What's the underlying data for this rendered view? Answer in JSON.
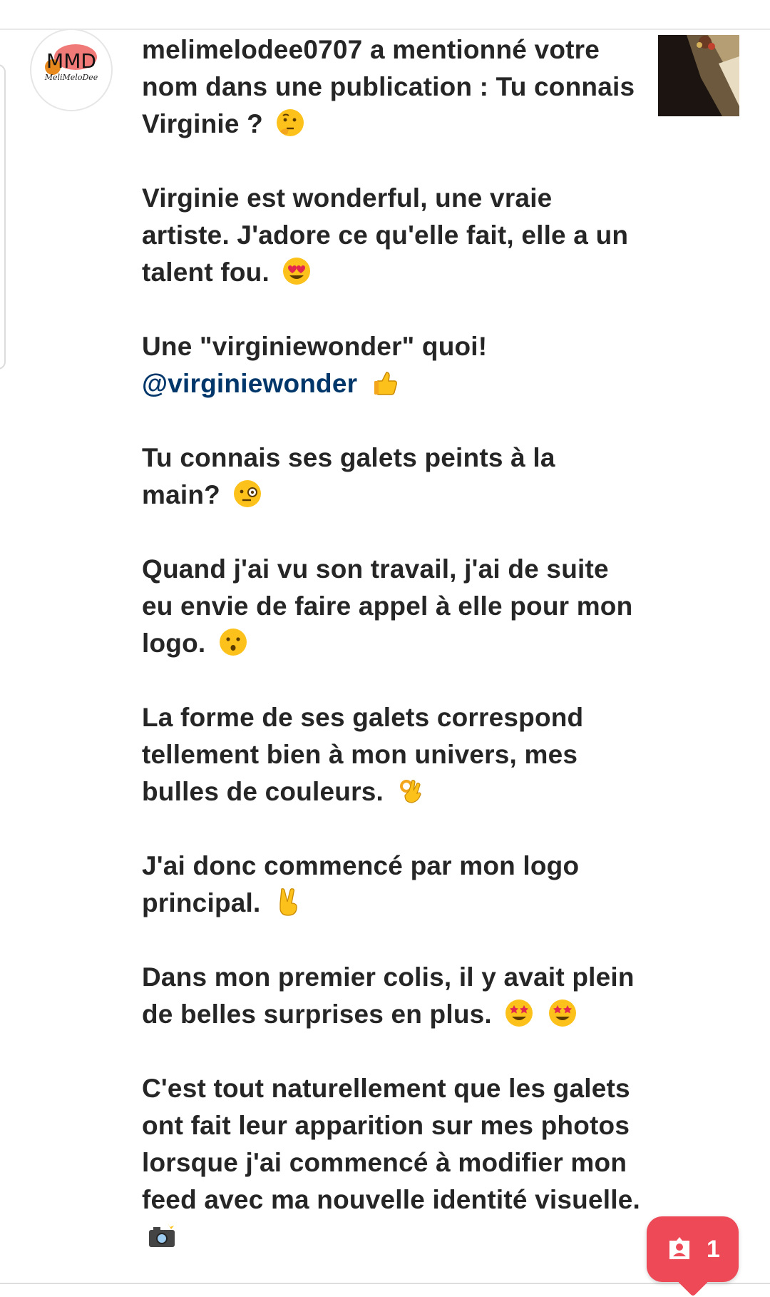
{
  "notification": {
    "username": "melimelodee0707",
    "mention_text": " a mentionné votre nom dans une publication : Tu connais Virginie ?",
    "paragraphs": [
      {
        "text": "Virginie est wonderful, une vraie artiste. J'adore ce qu'elle fait, elle a un talent fou.",
        "emoji": "heart-eyes-emoji"
      },
      {
        "text": "Une \"virginiewonder\" quoi!",
        "mention": "@virginiewonder",
        "emoji": "thumbs-up-emoji"
      },
      {
        "text": "Tu connais ses galets peints à la main?",
        "emoji": "monocle-emoji"
      },
      {
        "text": "Quand j'ai vu son travail, j'ai de suite eu envie de faire appel à elle pour mon logo.",
        "emoji": "hushed-emoji"
      },
      {
        "text": "La forme de ses galets correspond tellement bien à mon univers, mes bulles de couleurs.",
        "emoji": "ok-hand-emoji"
      },
      {
        "text": "J'ai donc commencé par mon logo principal.",
        "emoji": "victory-hand-emoji"
      },
      {
        "text": "Dans mon premier colis, il y avait plein de belles surprises en plus.",
        "emoji": "star-struck-emoji"
      },
      {
        "text": "C'est tout naturellement que les galets ont fait leur apparition sur mes photos lorsque j'ai commencé à modifier mon feed avec ma nouvelle identité visuelle.",
        "emoji": "camera-flash-emoji"
      }
    ],
    "first_emoji": "thinking-face-emoji"
  },
  "avatar": {
    "logo_text": "MMD",
    "logo_subtext": "MeliMeloDee"
  },
  "badge": {
    "count": "1",
    "icon": "person-tag-icon"
  },
  "colors": {
    "text": "#262626",
    "mention": "#00376b",
    "badge": "#ed4956",
    "avatar_blob": "#f07a78"
  }
}
